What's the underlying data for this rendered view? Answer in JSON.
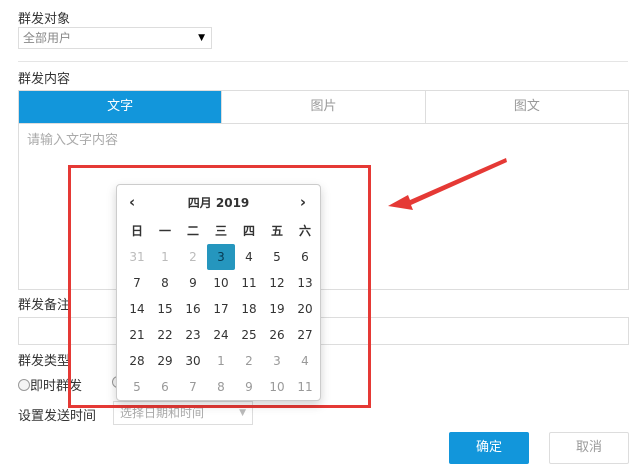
{
  "form": {
    "target_label": "群发对象",
    "target_select": "全部用户",
    "content_label": "群发内容",
    "tabs": [
      "文字",
      "图片",
      "图文"
    ],
    "text_placeholder": "请输入文字内容",
    "remark_label": "群发备注",
    "type_label": "群发类型",
    "type_option_immediate": "即时群发",
    "time_label": "设置发送时间",
    "time_placeholder": "选择日期和时间",
    "confirm": "确定",
    "cancel": "取消"
  },
  "calendar": {
    "title": "四月 2019",
    "weekdays": [
      "日",
      "一",
      "二",
      "三",
      "四",
      "五",
      "六"
    ],
    "weeks": [
      [
        "31",
        "1",
        "2",
        "3",
        "4",
        "5",
        "6"
      ],
      [
        "7",
        "8",
        "9",
        "10",
        "11",
        "12",
        "13"
      ],
      [
        "14",
        "15",
        "16",
        "17",
        "18",
        "19",
        "20"
      ],
      [
        "21",
        "22",
        "23",
        "24",
        "25",
        "26",
        "27"
      ],
      [
        "28",
        "29",
        "30",
        "1",
        "2",
        "3",
        "4"
      ],
      [
        "5",
        "6",
        "7",
        "8",
        "9",
        "10",
        "11"
      ]
    ],
    "selected": "3"
  },
  "colors": {
    "accent": "#1296db",
    "highlight": "#e53935"
  }
}
